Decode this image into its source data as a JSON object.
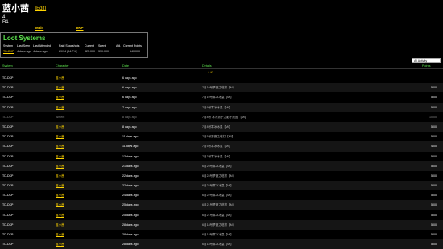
{
  "profile": {
    "name": "蓝小茜",
    "edit_label": "[Edit]",
    "line1": "4",
    "line2": "R1"
  },
  "tabs": {
    "main": "Main",
    "dkp": "DKP"
  },
  "loot": {
    "title": "Loot Systems",
    "headers": [
      "System",
      "Last Seen",
      "Last Attended",
      "Raid Snapshots",
      "Current",
      "Spent",
      "Adj.",
      "Current Points"
    ],
    "values": [
      "TD-DKP",
      "4 days ago",
      "4 days ago",
      "89/94 (94.7%)",
      "825.000",
      "370.000",
      "",
      "640.000"
    ]
  },
  "filter": {
    "value": "All Activity"
  },
  "table": {
    "headers": {
      "system": "System",
      "character": "Character",
      "date": "Date",
      "details": "Details",
      "points": "Points"
    },
    "pager": "1 2",
    "rows": [
      {
        "system": "TD-DKP",
        "character": "蓝小茜",
        "date": "6 days ago",
        "details": "",
        "points": "",
        "absent": false
      },
      {
        "system": "TD-DKP",
        "character": "蓝小茜",
        "date": "6 days ago",
        "details": "7月10号梦魔之塔打【Mi】",
        "points": "5.00",
        "absent": false
      },
      {
        "system": "TD-DKP",
        "character": "蓝小茜",
        "date": "6 days ago",
        "details": "7月10号寒冰冰皇【Mi】",
        "points": "5.00",
        "absent": false
      },
      {
        "system": "TD-DKP",
        "character": "蓝小茜",
        "date": "7 days ago",
        "details": "7月9号寒冰冰皇【Mi】",
        "points": "5.00",
        "absent": false
      },
      {
        "system": "TD-DKP",
        "character": "Absent",
        "date": "8 days ago",
        "details": "7月8号 冰冷男子之影子厄运 【Mi】",
        "points": "10.00",
        "absent": true
      },
      {
        "system": "TD-DKP",
        "character": "蓝小茜",
        "date": "8 days ago",
        "details": "7月8号寒冰冰皇【Mi】",
        "points": "5.00",
        "absent": false
      },
      {
        "system": "TD-DKP",
        "character": "蓝小茜",
        "date": "11 days ago",
        "details": "7月5号梦魔之塔打【Mi】",
        "points": "5.00",
        "absent": false
      },
      {
        "system": "TD-DKP",
        "character": "蓝小茜",
        "date": "11 days ago",
        "details": "7月5号寒冰冰皇【Mi】",
        "points": "4.00",
        "absent": false
      },
      {
        "system": "TD-DKP",
        "character": "蓝小茜",
        "date": "13 days ago",
        "details": "7月3号寒冰冰皇【Mi】",
        "points": "5.00",
        "absent": false
      },
      {
        "system": "TD-DKP",
        "character": "蓝小茜",
        "date": "21 days ago",
        "details": "6月25号寒冰冰皇【Mi】",
        "points": "5.00",
        "absent": false
      },
      {
        "system": "TD-DKP",
        "character": "蓝小茜",
        "date": "22 days ago",
        "details": "6月24号梦魔之塔打【Mi】",
        "points": "5.00",
        "absent": false
      },
      {
        "system": "TD-DKP",
        "character": "蓝小茜",
        "date": "22 days ago",
        "details": "6月24号寒冰冰皇【Mi】",
        "points": "5.00",
        "absent": false
      },
      {
        "system": "TD-DKP",
        "character": "蓝小茜",
        "date": "24 days ago",
        "details": "6月22号寒冰冰皇【Mi】",
        "points": "5.00",
        "absent": false
      },
      {
        "system": "TD-DKP",
        "character": "蓝小茜",
        "date": "25 days ago",
        "details": "6月21号梦魔之塔打【Mi】",
        "points": "5.00",
        "absent": false
      },
      {
        "system": "TD-DKP",
        "character": "蓝小茜",
        "date": "25 days ago",
        "details": "6月21号寒冰冰皇【Mi】",
        "points": "5.00",
        "absent": false
      },
      {
        "system": "TD-DKP",
        "character": "蓝小茜",
        "date": "28 days ago",
        "details": "6月18号梦魔之塔打【Mi】",
        "points": "5.00",
        "absent": false
      },
      {
        "system": "TD-DKP",
        "character": "蓝小茜",
        "date": "28 days ago",
        "details": "6月18号寒冰冰皇【Mi】",
        "points": "5.00",
        "absent": false
      },
      {
        "system": "TD-DKP",
        "character": "蓝小茜",
        "date": "28 days ago",
        "details": "6月18号寒冰冰皇【Mi】",
        "points": "5.00",
        "absent": false
      }
    ]
  }
}
